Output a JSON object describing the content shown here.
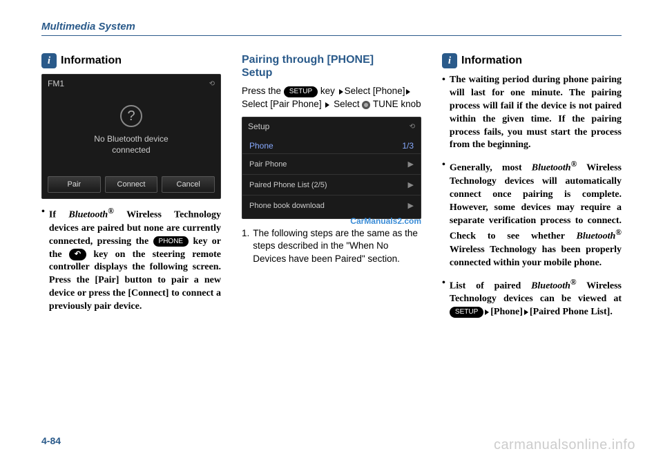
{
  "header": "Multimedia System",
  "page_number": "4-84",
  "watermark_center": "CarManuals2.com",
  "watermark_bottom": "carmanualsonline.info",
  "col1": {
    "title": "Information",
    "screenshot": {
      "title": "FM1",
      "message_l1": "No Bluetooth device",
      "message_l2": "connected",
      "btn1": "Pair",
      "btn2": "Connect",
      "btn3": "Cancel"
    },
    "bullet_prefix": "If ",
    "bullet_bt": "Bluetooth",
    "bullet_reg": "®",
    "bullet_part1": " Wireless Technology devices are paired but none are cur­rently connected, pressing the ",
    "key_phone": "PHONE",
    "bullet_part2": " key or the ",
    "key_call": "↶",
    "bullet_part3": " key on the steering remote controller displays the following screen. Press the [Pair] button to pair a new device or press the [Connect] to connect a previous­ly pair device."
  },
  "col2": {
    "title_l1": "Pairing through [PHONE]",
    "title_l2": "Setup",
    "instr_p1": "Press the ",
    "key_setup": "SETUP",
    "instr_p2": " key ",
    "instr_p3": "Select [Phone]",
    "instr_p4": "Select [Pair Phone] ",
    "instr_p5": "Select ",
    "instr_p6": "TUNE knob",
    "screenshot": {
      "title": "Setup",
      "header_label": "Phone",
      "header_page": "1/3",
      "item1": "Pair Phone",
      "item2": "Paired Phone List  (2/5)",
      "item3": "Phone book download"
    },
    "step_num": "1.",
    "step_text": "The following steps are the same as the steps described in the \"When No Devices have been Paired\" section."
  },
  "col3": {
    "title": "Information",
    "bullet1": "The waiting period during phone pairing will last for one minute. The pairing process will fail if the device is not paired within the given time. If the pairing process fails, you must start the process from the beginning.",
    "bullet2_p1": "Generally, most ",
    "bullet2_bt": "Bluetooth",
    "bullet2_reg": "®",
    "bullet2_p2": " Wireless Technology devices will automatical­ly connect once pairing is complete. However, some devices may require a separate verification process to connect. Check to see whether ",
    "bullet2_bt2": "Bluetooth",
    "bullet2_reg2": "®",
    "bullet2_p3": " Wireless Technology has been properly connected within your mobile phone.",
    "bullet3_p1": "List of paired ",
    "bullet3_bt": "Bluetooth",
    "bullet3_reg": "®",
    "bullet3_p2": " Wireless Technology devices can be viewed at ",
    "key_setup": "SETUP",
    "bullet3_p3": "[Phone]",
    "bullet3_p4": "[Paired Phone List]."
  }
}
